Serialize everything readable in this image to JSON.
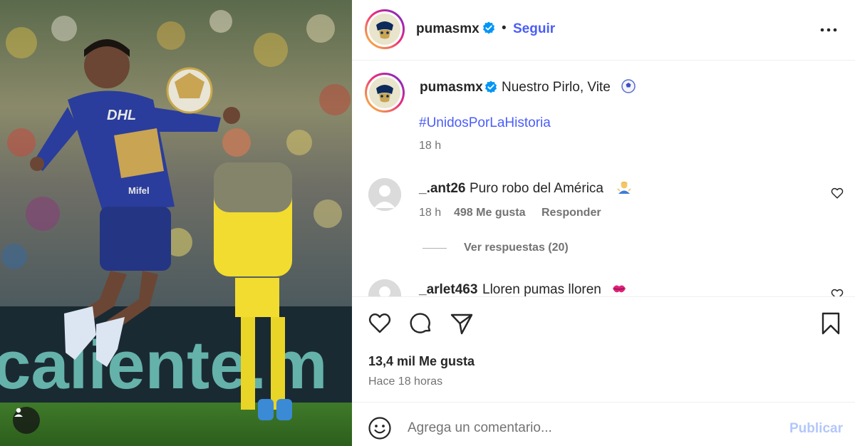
{
  "post": {
    "account": "pumasmx",
    "verified": true,
    "follow_label": "Seguir",
    "separator": "•",
    "more_icon": "more-horizontal-icon",
    "caption": {
      "text": "Nuestro Pirlo, Vite",
      "emoji": "soccer-ball-emoji",
      "hashtag": "#UnidosPorLaHistoria",
      "time": "18 h"
    },
    "comments": [
      {
        "user": "_.ant26",
        "text": "Puro robo del América",
        "emoji": "person-shrugging-emoji",
        "time": "18 h",
        "likes": "498 Me gusta",
        "reply_label": "Responder",
        "view_replies": "Ver respuestas (20)"
      },
      {
        "user": "_arlet463",
        "text": "Lloren pumas lloren",
        "emoji": "kiss-mark-emoji"
      }
    ],
    "likes_count": "13,4 mil Me gusta",
    "posted_ago": "Hace 18 horas",
    "comment_placeholder": "Agrega un comentario...",
    "publish_label": "Publicar"
  },
  "colors": {
    "link_blue": "#4a5df9",
    "publish_disabled": "#b3c7fb",
    "secondary_text": "#737373",
    "pumas_blue": "#2a3d9c",
    "america_yellow": "#f2dc2f"
  }
}
